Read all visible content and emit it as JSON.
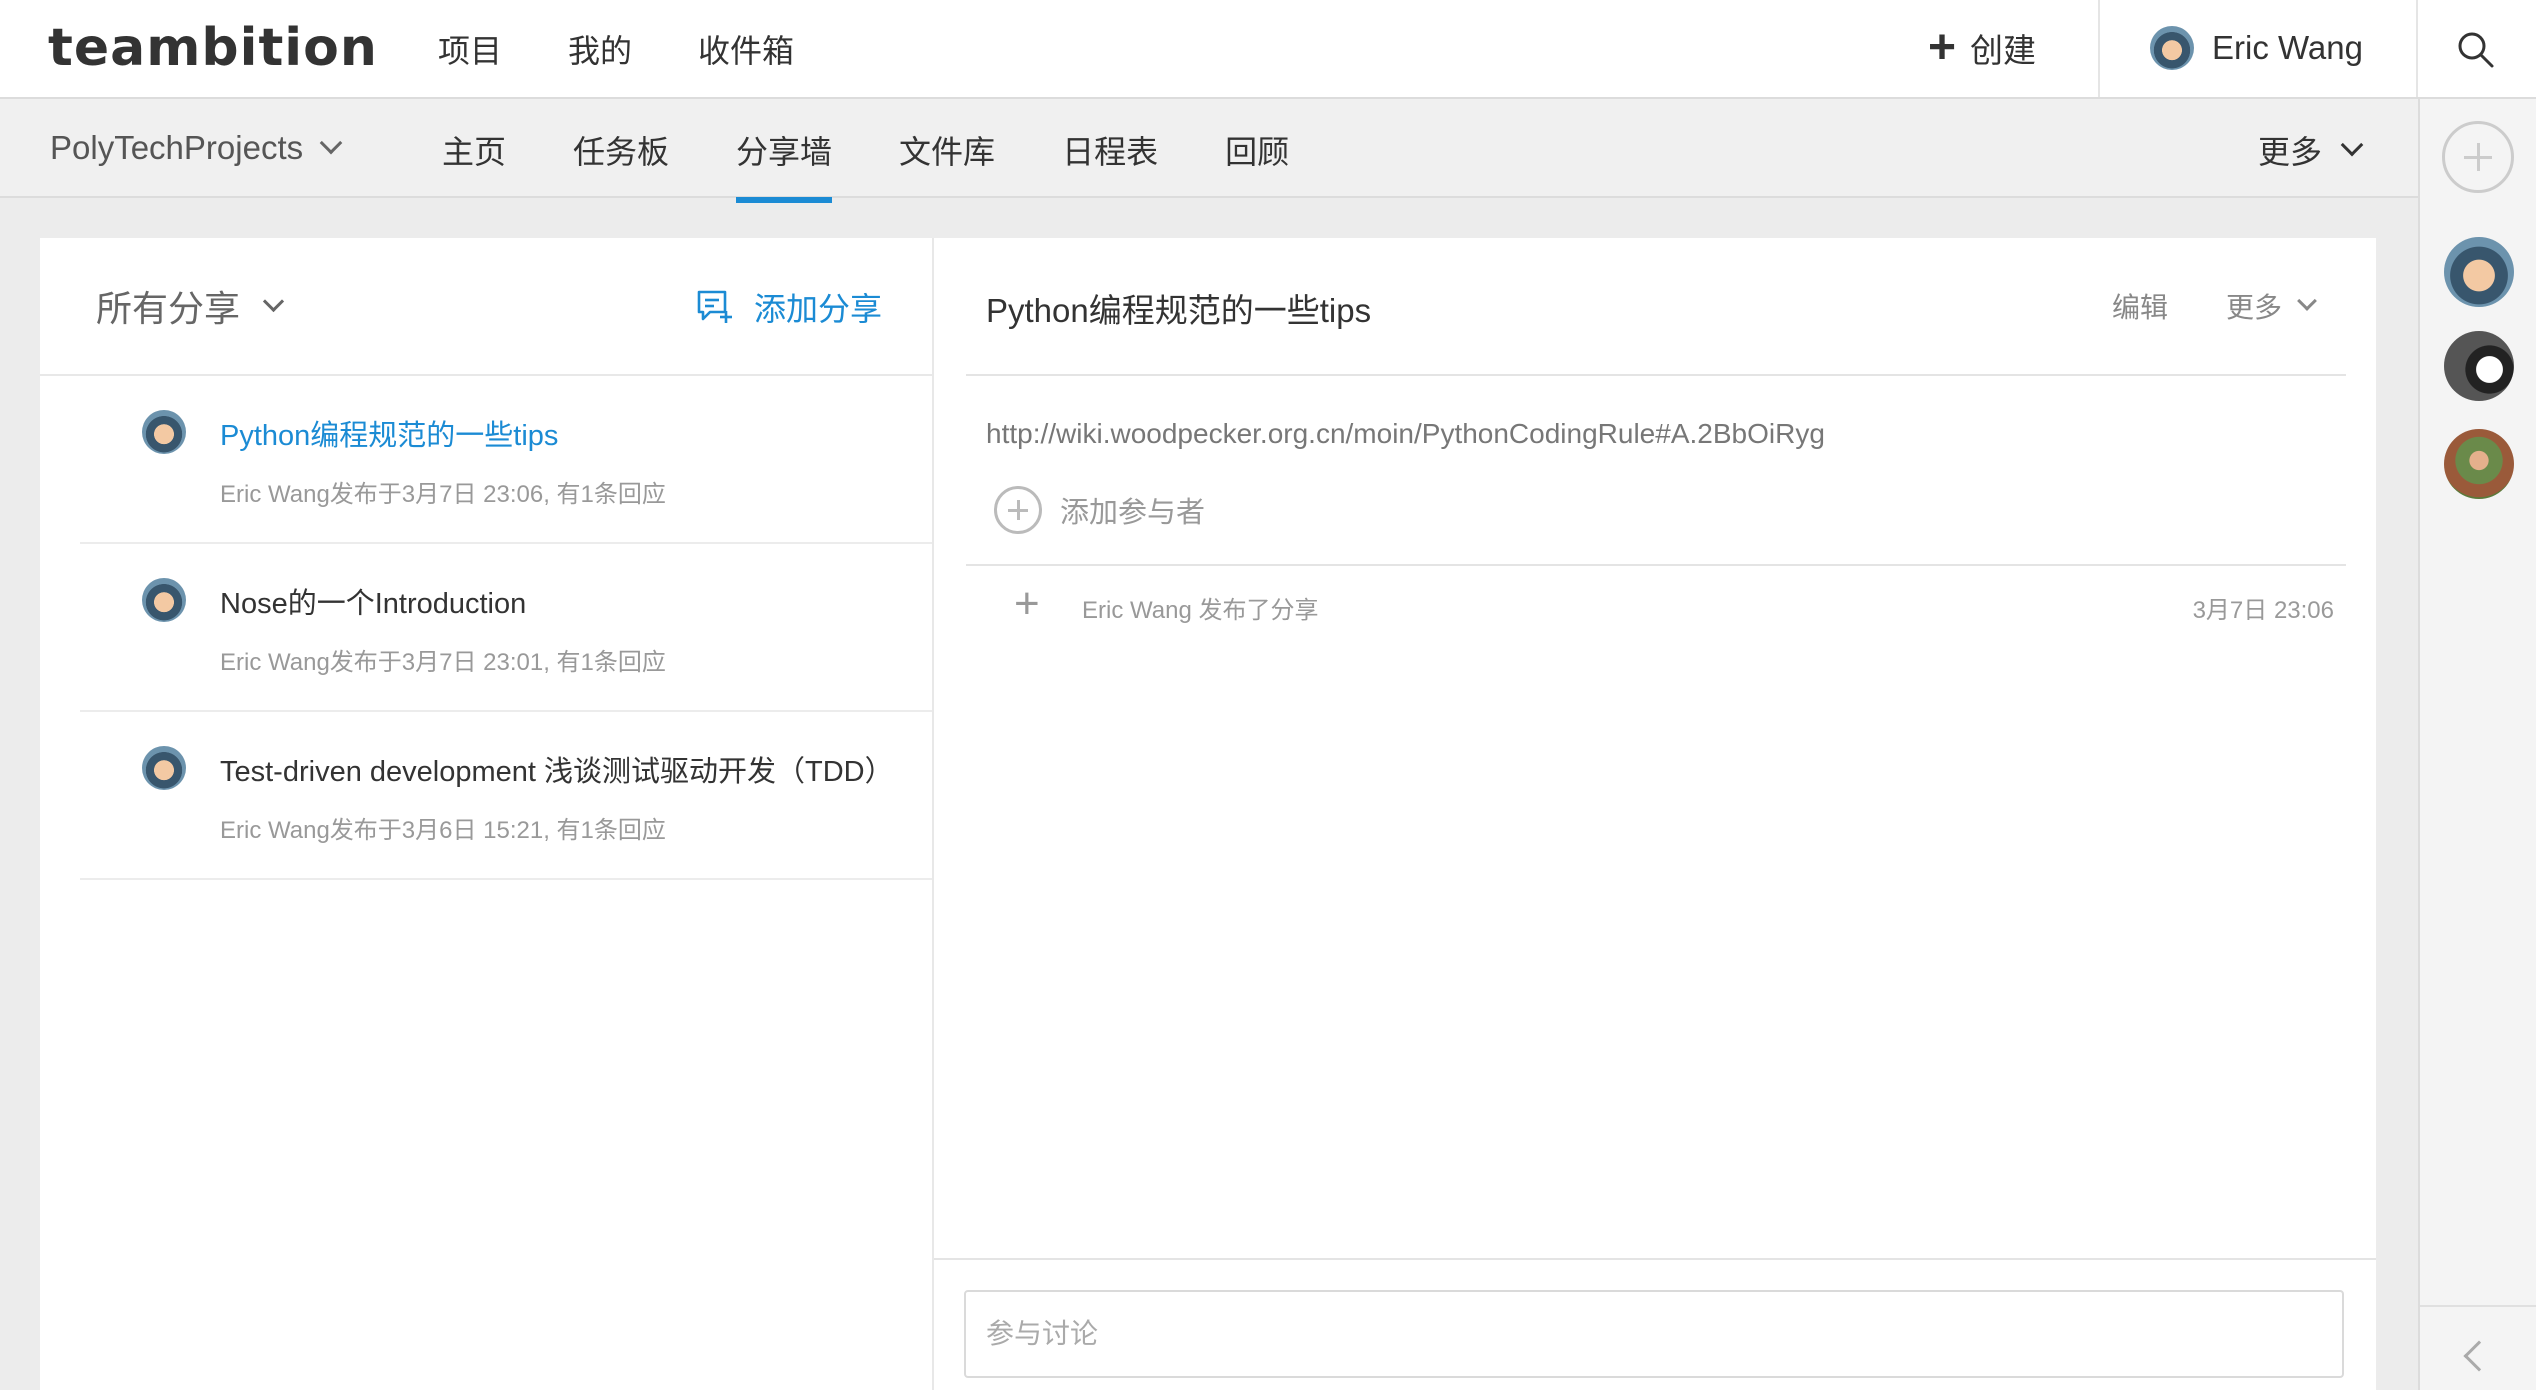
{
  "header": {
    "logo": "teambition",
    "nav": [
      "项目",
      "我的",
      "收件箱"
    ],
    "create_label": "创建",
    "user_name": "Eric Wang"
  },
  "subnav": {
    "project_name": "PolyTechProjects",
    "tabs": [
      "主页",
      "任务板",
      "分享墙",
      "文件库",
      "日程表",
      "回顾"
    ],
    "active_tab": "分享墙",
    "more_label": "更多"
  },
  "list": {
    "filter_label": "所有分享",
    "add_label": "添加分享",
    "items": [
      {
        "title": "Python编程规范的一些tips",
        "meta": "Eric Wang发布于3月7日 23:06, 有1条回应",
        "active": true
      },
      {
        "title": "Nose的一个Introduction",
        "meta": "Eric Wang发布于3月7日 23:01, 有1条回应",
        "active": false
      },
      {
        "title": "Test-driven development 浅谈测试驱动开发（TDD）",
        "meta": "Eric Wang发布于3月6日 15:21, 有1条回应",
        "active": false
      }
    ]
  },
  "detail": {
    "title": "Python编程规范的一些tips",
    "edit_label": "编辑",
    "more_label": "更多",
    "link": "http://wiki.woodpecker.org.cn/moin/PythonCodingRule#A.2BbOiRyg",
    "add_member_label": "添加参与者",
    "activity_text": "Eric Wang 发布了分享",
    "activity_time": "3月7日 23:06",
    "comment_placeholder": "参与讨论"
  },
  "colors": {
    "accent": "#1b8bd4",
    "background": "#ececec"
  }
}
